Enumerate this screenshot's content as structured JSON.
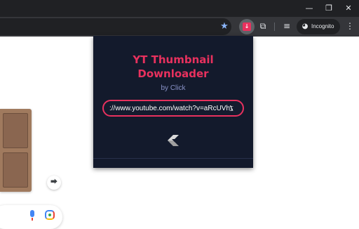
{
  "window": {
    "controls": [
      "minimize",
      "restore",
      "close"
    ]
  },
  "toolbar": {
    "bookmark_icon": "star-icon",
    "active_extension_icon": "yt-thumbnail-downloader-icon",
    "extensions_icon": "puzzle-icon",
    "media_icon": "media-control-icon",
    "incognito_label": "Incognito",
    "menu_icon": "kebab-menu-icon"
  },
  "popup": {
    "title_line1": "YT Thumbnail",
    "title_line2": "Downloader",
    "byline": "by Click",
    "url_value": "://www.youtube.com/watch?v=aRcUVhVISHgs",
    "accent_color": "#e8315e",
    "background_color": "#131a2c",
    "logo_icon": "click-logo-icon"
  },
  "page": {
    "share_icon": "share-icon",
    "mic_icon": "microphone-icon",
    "lens_icon": "google-lens-icon"
  }
}
